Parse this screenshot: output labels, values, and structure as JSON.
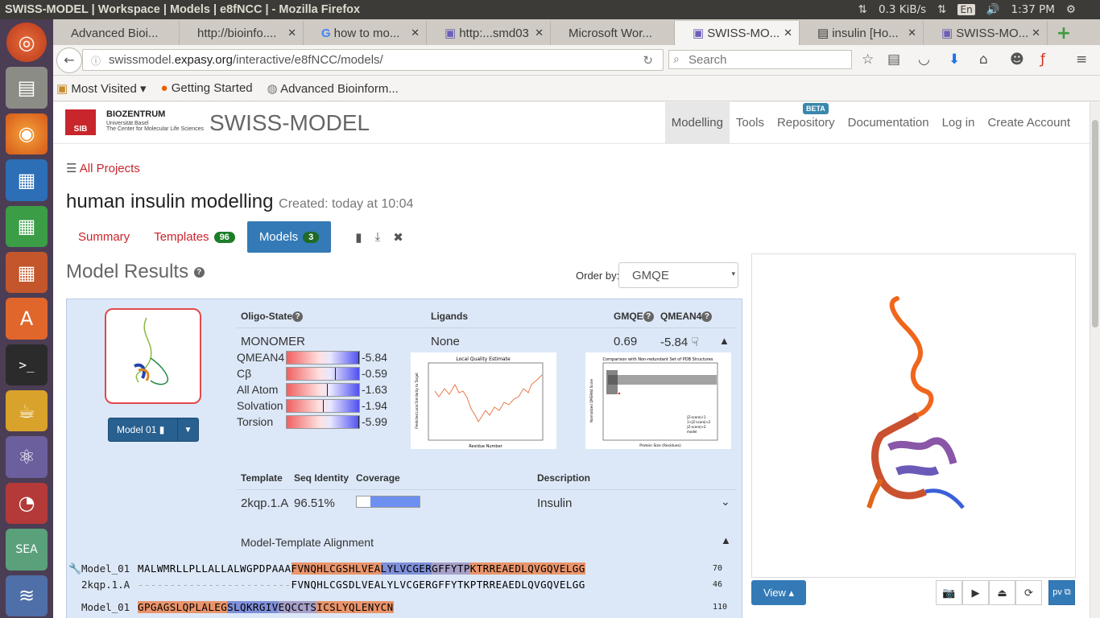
{
  "os": {
    "window_title": "SWISS-MODEL | Workspace | Models | e8fNCC | - Mozilla Firefox",
    "net_speed": "0.3 KiB/s",
    "lang": "En",
    "clock": "1:37 PM"
  },
  "tabs": [
    {
      "label": "Advanced Bioi..."
    },
    {
      "label": "http://bioinfo...."
    },
    {
      "label": "how to mo..."
    },
    {
      "label": "http:...smd03"
    },
    {
      "label": "Microsoft Wor..."
    },
    {
      "label": "SWISS-MO..."
    },
    {
      "label": "insulin [Ho..."
    },
    {
      "label": "SWISS-MO..."
    }
  ],
  "nav": {
    "url_prefix": "swissmodel.",
    "url_domain": "expasy.org",
    "url_path": "/interactive/e8fNCC/models/",
    "search_placeholder": "Search"
  },
  "bookmarks": {
    "most_visited": "Most Visited",
    "getting_started": "Getting Started",
    "advanced": "Advanced Bioinform..."
  },
  "site": {
    "logo_text": "SIB",
    "biozentrum": "BIOZENTRUM",
    "uni": "Universität Basel",
    "center": "The Center for Molecular Life Sciences",
    "brand": "SWISS-MODEL",
    "beta": "BETA",
    "menu": [
      "Modelling",
      "Tools",
      "Repository",
      "Documentation",
      "Log in",
      "Create Account"
    ]
  },
  "project": {
    "all_projects": "All Projects",
    "title": "human insulin modelling",
    "created": "Created: today at 10:04",
    "tabs": {
      "summary": "Summary",
      "templates": "Templates",
      "templates_count": "96",
      "models": "Models",
      "models_count": "3"
    }
  },
  "results": {
    "heading": "Model Results",
    "order_label": "Order by:",
    "order_value": "GMQE",
    "model_button": "Model 01",
    "headers": {
      "oligo": "Oligo-State",
      "ligands": "Ligands",
      "gmqe": "GMQE",
      "qmean": "QMEAN4"
    },
    "oligo": "MONOMER",
    "ligands": "None",
    "gmqe": "0.69",
    "qmean": "-5.84",
    "scores": [
      {
        "label": "QMEAN4",
        "value": "-5.84",
        "level": 0.99
      },
      {
        "label": "Cβ",
        "value": "-0.59",
        "level": 0.67
      },
      {
        "label": "All Atom",
        "value": "-1.63",
        "level": 0.55
      },
      {
        "label": "Solvation",
        "value": "-1.94",
        "level": 0.5
      },
      {
        "label": "Torsion",
        "value": "-5.99",
        "level": 0.99
      }
    ],
    "plot1_title": "Local Quality Estimate",
    "plot1_x": "Residue Number",
    "plot1_y": "Predicted Local Similarity to Target",
    "plot2_title": "Comparison with Non-redundant Set of PDB Structures",
    "plot2_x": "Protein Size (Residues)",
    "plot2_y": "Normalized QMEAN4 Score",
    "plot2_legend": [
      "|Z-score|<1",
      "1<|Z-score|<2",
      "|Z-score|>2",
      "model"
    ],
    "template_headers": {
      "template": "Template",
      "seqid": "Seq Identity",
      "coverage": "Coverage",
      "desc": "Description"
    },
    "template": "2kqp.1.A",
    "seqid": "96.51%",
    "coverage": 0.78,
    "description": "Insulin",
    "alignment_title": "Model-Template Alignment",
    "alignment": [
      {
        "name": "Model_01",
        "seq": "MALWMRLLPLLALLALWGPDPAAAFVNQHLCGSHLVEALYLVCGERGFFYTPKTRREAEDLQVGQVELGG",
        "end": "70"
      },
      {
        "name": "2kqp.1.A",
        "seq": "------------------------FVNQHLCGSDLVEALYLVCGERGFFYTKPTRREAEDLQVGQVELGG",
        "end": "46"
      },
      {
        "name": "Model_01",
        "seq": "GPGAGSLQPLALEGSLQKRGIVEQCCTSICSLYQLENYCN",
        "end": "110"
      }
    ],
    "viewer": {
      "view_label": "View"
    }
  }
}
